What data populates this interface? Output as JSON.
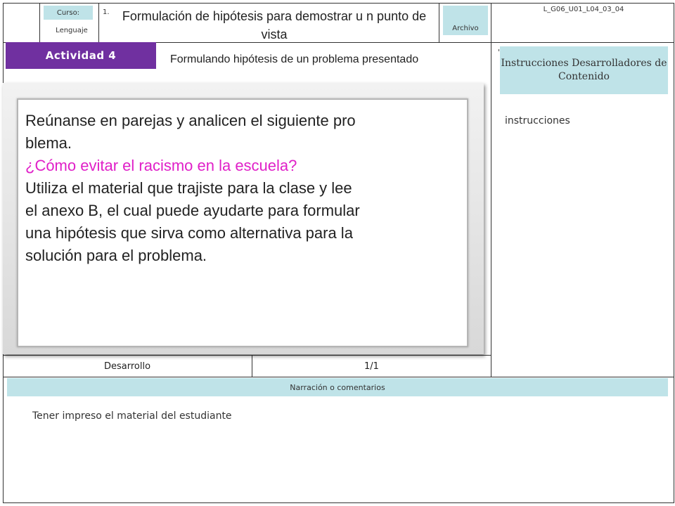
{
  "header": {
    "curso_label": "Curso:",
    "curso_value": "Lenguaje",
    "number": "1.",
    "title": "Formulación de hipótesis para demostrar u n punto de vista",
    "archivo_label": "Archivo",
    "file_code": "L_G06_U01_L04_03_04"
  },
  "activity": {
    "tag": "Actividad 4",
    "subtitle": "Formulando hipótesis de un problema presentado"
  },
  "instructions": {
    "header": "Instrucciones Desarrolladores de Contenido",
    "text": "instrucciones"
  },
  "card": {
    "lines": [
      "Reúnanse en parejas y analicen el siguiente pro",
      "blema.",
      "¿Cómo evitar el racismo en la escuela?",
      "Utiliza el material que trajiste para la clase y lee",
      "el anexo B, el cual puede ayudarte para formular",
      "una hipótesis que sirva como  alternativa para la",
      "solución para el problema."
    ],
    "question_color": "#e020c8"
  },
  "footer_row": {
    "stage": "Desarrollo",
    "page": "1/1"
  },
  "narration": {
    "header": "Narración o comentarios",
    "text": "Tener impreso el material del estudiante"
  },
  "colors": {
    "accent_tag": "#bfe3e8",
    "activity_purple": "#7030a0"
  }
}
